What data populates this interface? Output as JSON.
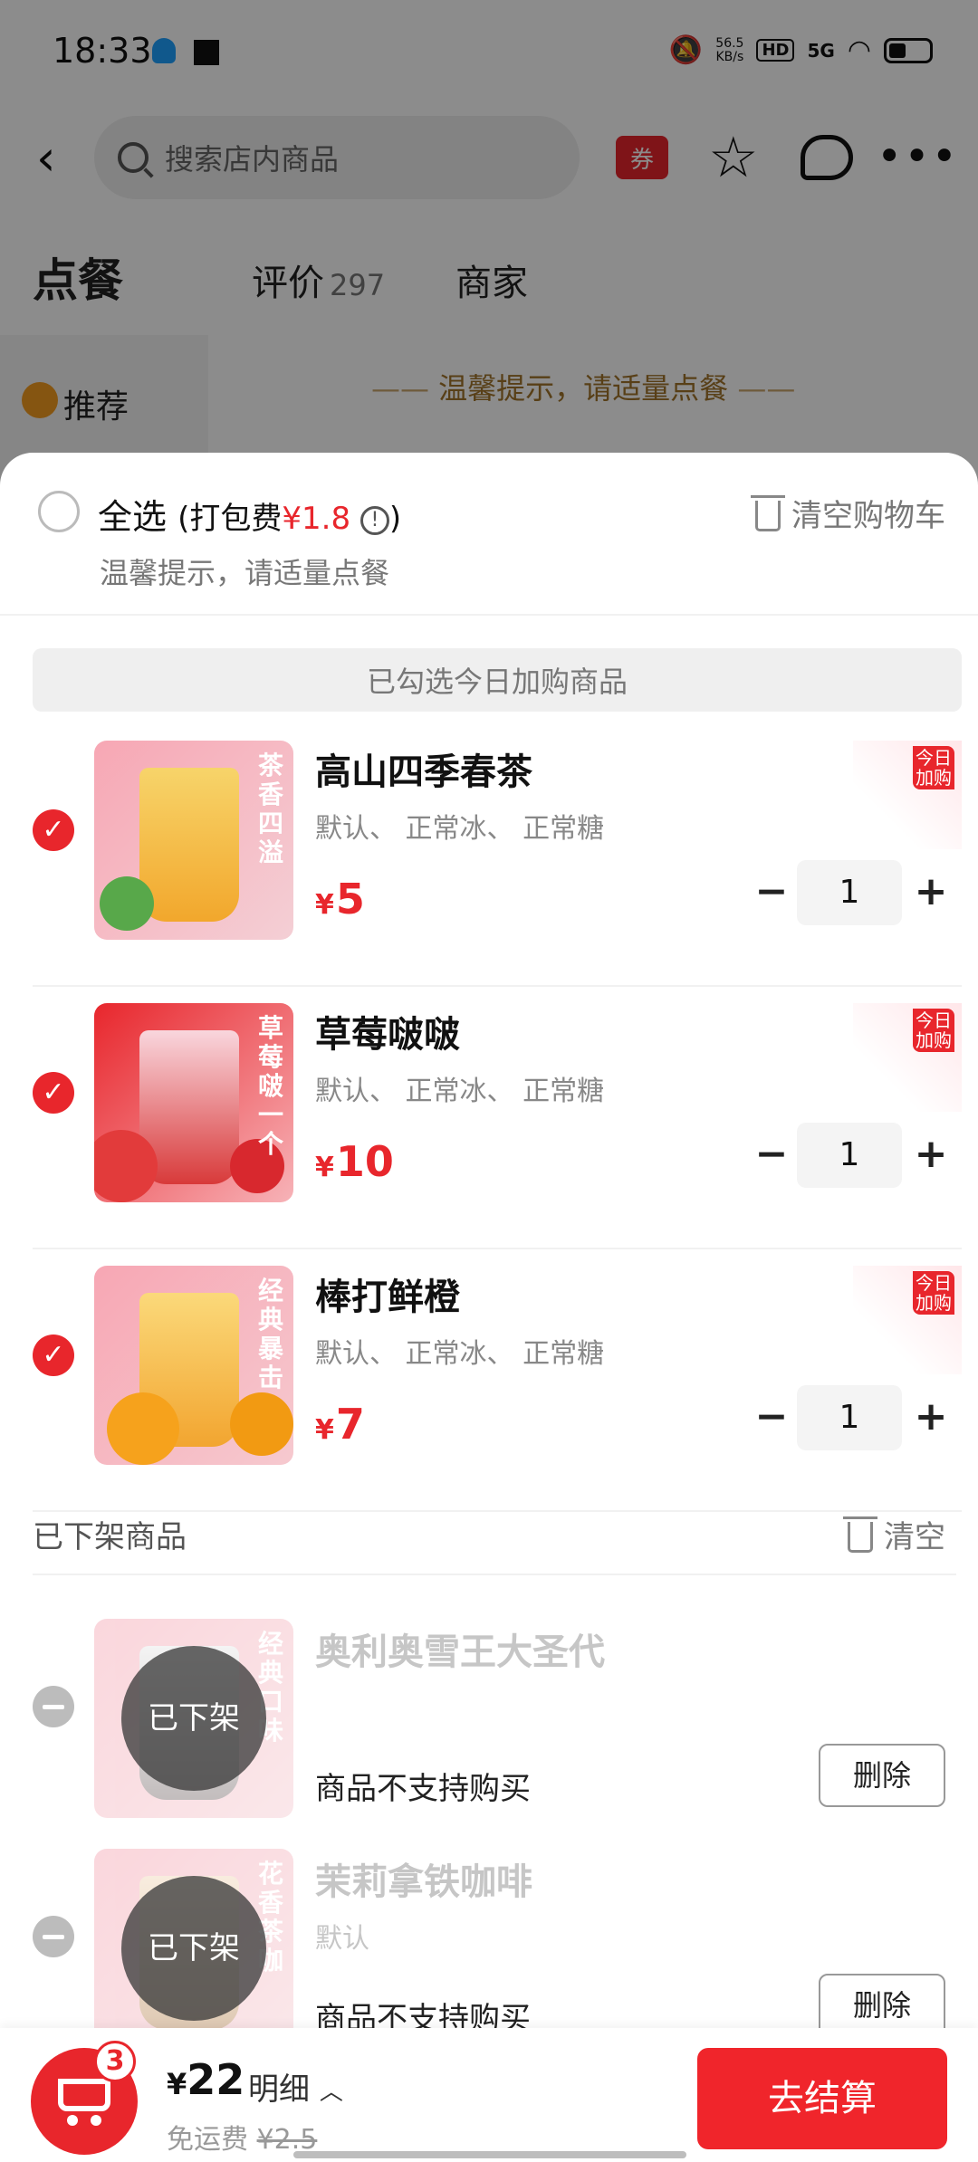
{
  "status": {
    "time": "18:33",
    "speed_value": "56.5",
    "speed_unit": "KB/s",
    "hd": "HD",
    "network": "5G"
  },
  "nav": {
    "search_placeholder": "搜索店内商品",
    "coupon": "券"
  },
  "tabs": {
    "order": "点餐",
    "reviews": "评价",
    "reviews_count": "297",
    "merchant": "商家"
  },
  "side": {
    "recommend": "推荐"
  },
  "banner_tip": "温馨提示，请适量点餐",
  "cart": {
    "select_all": "全选",
    "pack_fee_prefix": "(打包费",
    "pack_fee": "¥1.8",
    "pack_fee_suffix": ")",
    "tip": "温馨提示，请适量点餐",
    "clear": "清空购物车",
    "section_label": "已勾选今日加购商品",
    "items": [
      {
        "name": "高山四季春茶",
        "spec": "默认、 正常冰、 正常糖",
        "price": "5",
        "qty": "1",
        "tag": "今日加购",
        "img_text": "茶香四溢"
      },
      {
        "name": "草莓啵啵",
        "spec": "默认、 正常冰、 正常糖",
        "price": "10",
        "qty": "1",
        "tag": "今日加购",
        "img_text": "草莓啵一个"
      },
      {
        "name": "棒打鲜橙",
        "spec": "默认、 正常冰、 正常糖",
        "price": "7",
        "qty": "1",
        "tag": "今日加购",
        "img_text": "经典暴击"
      }
    ],
    "offline": {
      "title": "已下架商品",
      "clear": "清空",
      "items": [
        {
          "name": "奥利奥雪王大圣代",
          "spec": "",
          "overlay": "已下架",
          "reason": "商品不支持购买",
          "delete": "删除",
          "img_text": "经典口味"
        },
        {
          "name": "茉莉拿铁咖啡",
          "spec": "默认",
          "overlay": "已下架",
          "reason": "商品不支持购买",
          "delete": "删除",
          "img_text": "花香茶咖"
        }
      ]
    }
  },
  "bottom": {
    "count": "3",
    "yen": "¥",
    "total": "22",
    "detail": "明细",
    "ship_label": "免运费",
    "ship_old": "¥2.5",
    "checkout": "去结算"
  },
  "colors": {
    "accent": "#e8262c",
    "tip": "#a0742a"
  }
}
